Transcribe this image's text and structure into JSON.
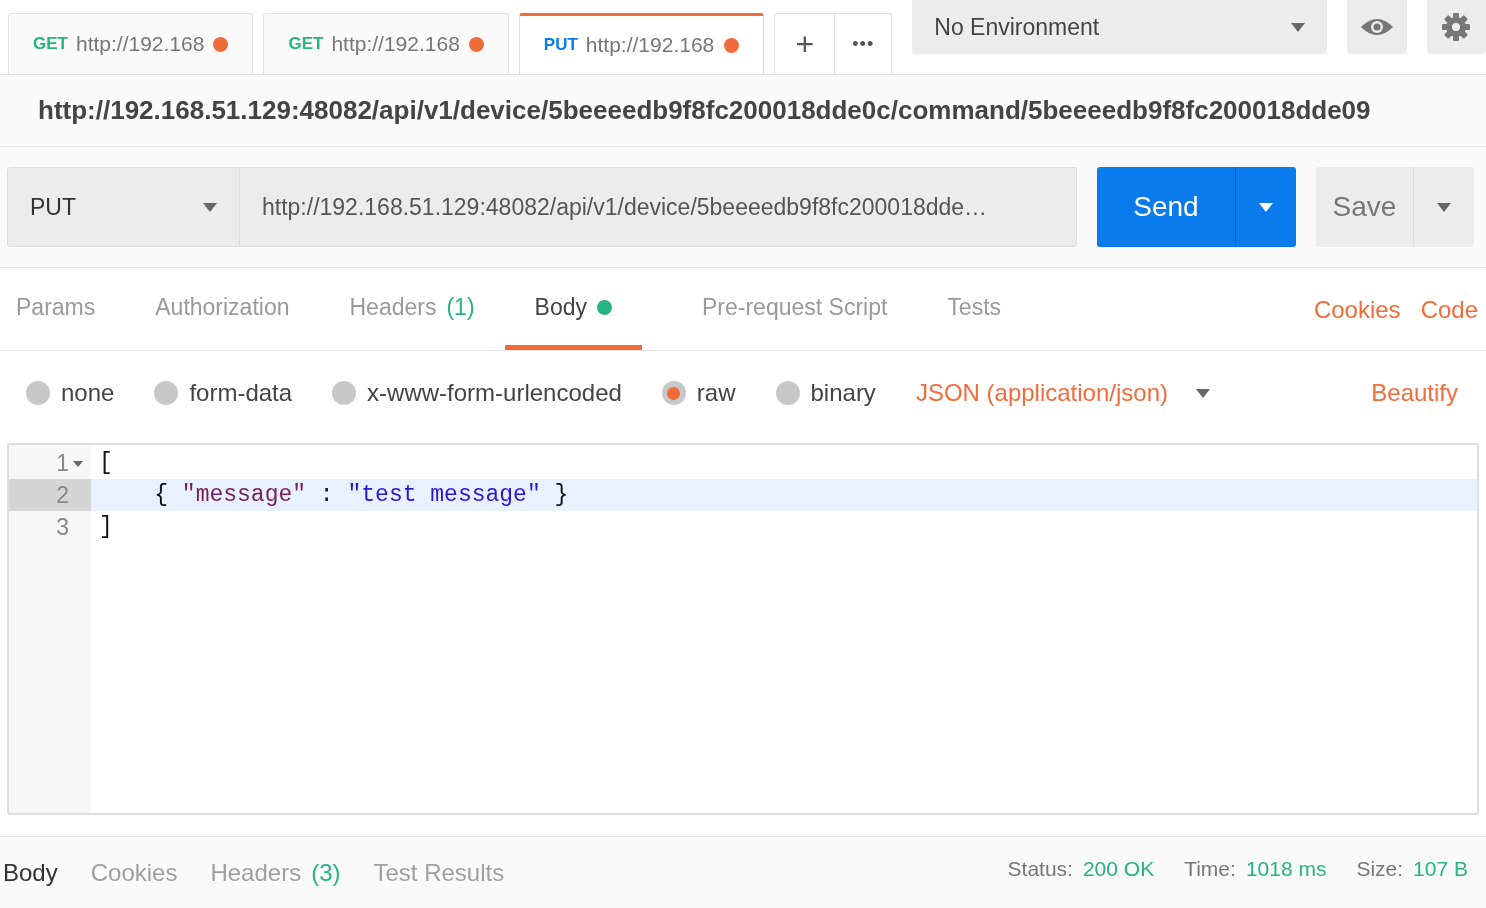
{
  "tabs": [
    {
      "method": "GET",
      "color": "#26b47f",
      "url": "http://192.168",
      "modified": true,
      "selected": false
    },
    {
      "method": "GET",
      "color": "#26b47f",
      "url": "http://192.168",
      "modified": true,
      "selected": false
    },
    {
      "method": "PUT",
      "color": "#097bed",
      "url": "http://192.168",
      "modified": true,
      "selected": true
    }
  ],
  "new_tab": "+",
  "more_tabs": "•••",
  "environment": {
    "value": "No Environment"
  },
  "request_title": "http://192.168.51.129:48082/api/v1/device/5beeeedb9f8fc200018dde0c/command/5beeeedb9f8fc200018dde09",
  "request": {
    "method": "PUT",
    "url": "http://192.168.51.129:48082/api/v1/device/5beeeedb9f8fc200018dde…",
    "send": "Send",
    "save": "Save"
  },
  "request_tabs": [
    {
      "label": "Params",
      "selected": false
    },
    {
      "label": "Authorization",
      "selected": false
    },
    {
      "label": "Headers",
      "count": "(1)",
      "selected": false
    },
    {
      "label": "Body",
      "indicator": true,
      "selected": true
    },
    {
      "label": "Pre-request Script",
      "selected": false
    },
    {
      "label": "Tests",
      "selected": false
    }
  ],
  "links": [
    "Cookies",
    "Code"
  ],
  "body_types": [
    {
      "label": "none",
      "selected": false
    },
    {
      "label": "form-data",
      "selected": false
    },
    {
      "label": "x-www-form-urlencoded",
      "selected": false
    },
    {
      "label": "raw",
      "selected": true
    },
    {
      "label": "binary",
      "selected": false
    }
  ],
  "format": "JSON (application/json)",
  "beautify": "Beautify",
  "editor": [
    {
      "number": "1",
      "foldable": true,
      "active": false,
      "tokens": [
        {
          "kind": "punct",
          "text": "["
        }
      ]
    },
    {
      "number": "2",
      "foldable": false,
      "active": true,
      "tokens": [
        {
          "kind": "punct",
          "text": "    { "
        },
        {
          "kind": "key",
          "text": "\"message\""
        },
        {
          "kind": "punct",
          "text": " : "
        },
        {
          "kind": "string",
          "text": "\"test message\""
        },
        {
          "kind": "punct",
          "text": " }"
        }
      ]
    },
    {
      "number": "3",
      "foldable": false,
      "active": false,
      "tokens": [
        {
          "kind": "punct",
          "text": "]"
        }
      ]
    }
  ],
  "response_tabs": [
    {
      "label": "Body",
      "selected": true
    },
    {
      "label": "Cookies",
      "selected": false
    },
    {
      "label": "Headers",
      "count": "(3)",
      "selected": false
    },
    {
      "label": "Test Results",
      "selected": false
    }
  ],
  "status": [
    {
      "label": "Status:",
      "value": "200 OK"
    },
    {
      "label": "Time:",
      "value": "1018 ms"
    },
    {
      "label": "Size:",
      "value": "107 B"
    }
  ]
}
